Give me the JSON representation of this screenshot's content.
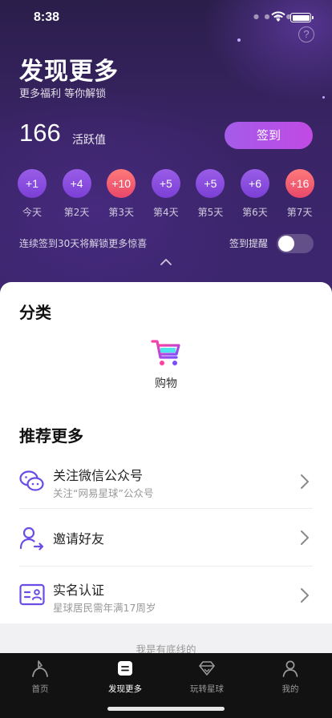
{
  "status_bar": {
    "time": "8:38"
  },
  "header": {
    "title": "发现更多",
    "subtitle": "更多福利 等你解锁",
    "help_glyph": "?"
  },
  "points": {
    "value": "166",
    "label": "活跃值"
  },
  "checkin": {
    "button_label": "签到"
  },
  "days": [
    {
      "reward": "+1",
      "label": "今天",
      "bonus": false
    },
    {
      "reward": "+4",
      "label": "第2天",
      "bonus": false
    },
    {
      "reward": "+10",
      "label": "第3天",
      "bonus": true
    },
    {
      "reward": "+5",
      "label": "第4天",
      "bonus": false
    },
    {
      "reward": "+5",
      "label": "第5天",
      "bonus": false
    },
    {
      "reward": "+6",
      "label": "第6天",
      "bonus": false
    },
    {
      "reward": "+16",
      "label": "第7天",
      "bonus": true
    }
  ],
  "streak": {
    "text": "连续签到30天将解锁更多惊喜",
    "reminder_label": "签到提醒",
    "reminder_on": false
  },
  "categories": {
    "title": "分类",
    "items": [
      {
        "label": "购物",
        "icon": "shopping-cart-icon"
      }
    ]
  },
  "recommend": {
    "title": "推荐更多",
    "items": [
      {
        "title": "关注微信公众号",
        "subtitle": "关注“网易星球”公众号",
        "icon": "wechat-icon"
      },
      {
        "title": "邀请好友",
        "subtitle": "",
        "icon": "invite-user-icon"
      },
      {
        "title": "实名认证",
        "subtitle": "星球居民需年满17周岁",
        "icon": "id-card-icon"
      }
    ]
  },
  "footer": {
    "text": "我是有底线的"
  },
  "tabbar": {
    "items": [
      {
        "label": "首页",
        "icon": "flag-icon",
        "active": false
      },
      {
        "label": "发现更多",
        "icon": "discover-icon",
        "active": true
      },
      {
        "label": "玩转星球",
        "icon": "diamond-icon",
        "active": false
      },
      {
        "label": "我的",
        "icon": "profile-icon",
        "active": false
      }
    ]
  },
  "colors": {
    "accent_purple": "#a45be8",
    "bonus_red": "#e8476a",
    "hero_bg": "#3a2466",
    "tabbar_bg": "#121212"
  }
}
